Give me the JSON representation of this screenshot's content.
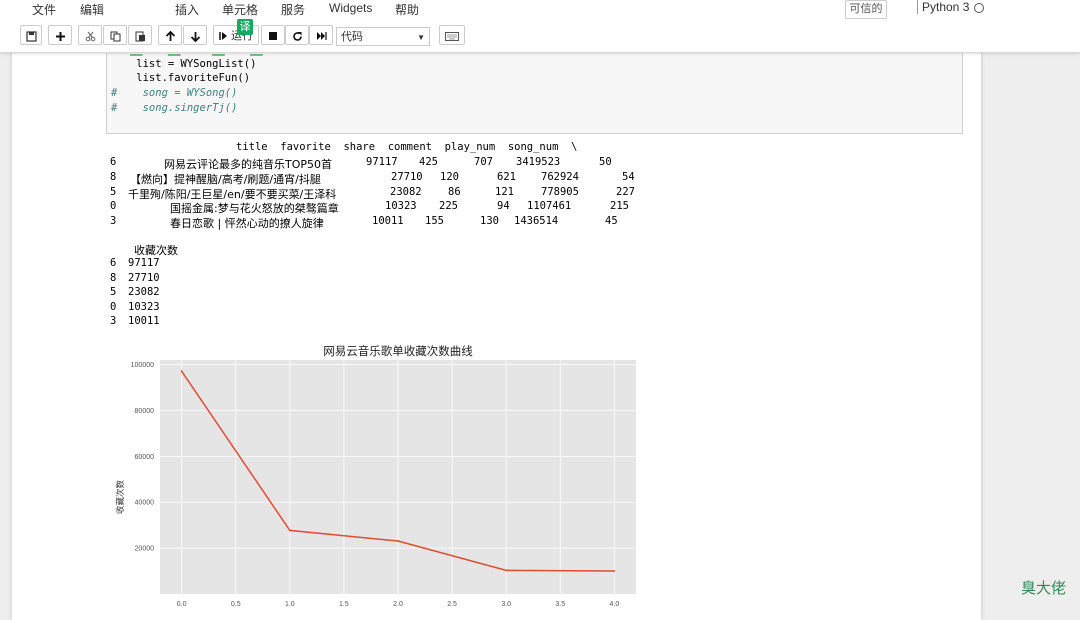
{
  "menubar": {
    "items": [
      "文件",
      "编辑",
      "插入",
      "单元格",
      "服务",
      "Widgets",
      "帮助"
    ],
    "trusted_label": "可信的",
    "kernel_label": "Python 3"
  },
  "toolbar": {
    "run_label": "运行",
    "celltype_value": "代码",
    "translate_badge": "译"
  },
  "code": {
    "lines": [
      "if __name__ == '__main__':",
      "    list = WYSongList()",
      "    list.favoriteFun()",
      "#    song = WYSong()",
      "#    song.singerTj()"
    ]
  },
  "output": {
    "df_header": "title  favorite  share  comment  play_num  song_num  \\",
    "df_rows": [
      {
        "idx": "6",
        "title": "网易云评论最多的纯音乐TOP50首",
        "favorite": "97117",
        "share": "425",
        "comment": "707",
        "play_num": "3419523",
        "song_num": "50"
      },
      {
        "idx": "8",
        "title": "【燃向】提神醒脑/高考/刷题/通宵/抖腿",
        "favorite": "27710",
        "share": "120",
        "comment": "621",
        "play_num": "762924",
        "song_num": "54"
      },
      {
        "idx": "5",
        "title": "千里殉/陈阳/王巨星/en/要不要买菜/王泽科",
        "favorite": "23082",
        "share": "86",
        "comment": "121",
        "play_num": "778905",
        "song_num": "227"
      },
      {
        "idx": "0",
        "title": "国摇金属:梦与花火怒放的桀骜篇章",
        "favorite": "10323",
        "share": "225",
        "comment": "94",
        "play_num": "1107461",
        "song_num": "215"
      },
      {
        "idx": "3",
        "title": "春日恋歌 | 怦然心动的撩人旋律",
        "favorite": "10011",
        "share": "155",
        "comment": "130",
        "play_num": "1436514",
        "song_num": "45"
      }
    ],
    "series_header": "收藏次数",
    "series_rows": [
      {
        "idx": "6",
        "val": "97117"
      },
      {
        "idx": "8",
        "val": "27710"
      },
      {
        "idx": "5",
        "val": "23082"
      },
      {
        "idx": "0",
        "val": "10323"
      },
      {
        "idx": "3",
        "val": "10011"
      }
    ]
  },
  "chart_data": {
    "type": "line",
    "title": "网易云音乐歌单收藏次数曲线",
    "xlabel": "",
    "ylabel": "收藏次数",
    "x": [
      0,
      1,
      2,
      3,
      4
    ],
    "series": [
      {
        "values": [
          97117,
          27710,
          23082,
          10323,
          10011
        ],
        "color": "#e24a33"
      }
    ],
    "xticks": [
      "0.0",
      "0.5",
      "1.0",
      "1.5",
      "2.0",
      "2.5",
      "3.0",
      "3.5",
      "4.0"
    ],
    "yticks": [
      "20000",
      "40000",
      "60000",
      "80000",
      "100000"
    ],
    "xlim": [
      -0.2,
      4.2
    ],
    "ylim": [
      0,
      102000
    ],
    "grid": true,
    "background": "#e5e5e5"
  },
  "watermark": "臭大佬"
}
